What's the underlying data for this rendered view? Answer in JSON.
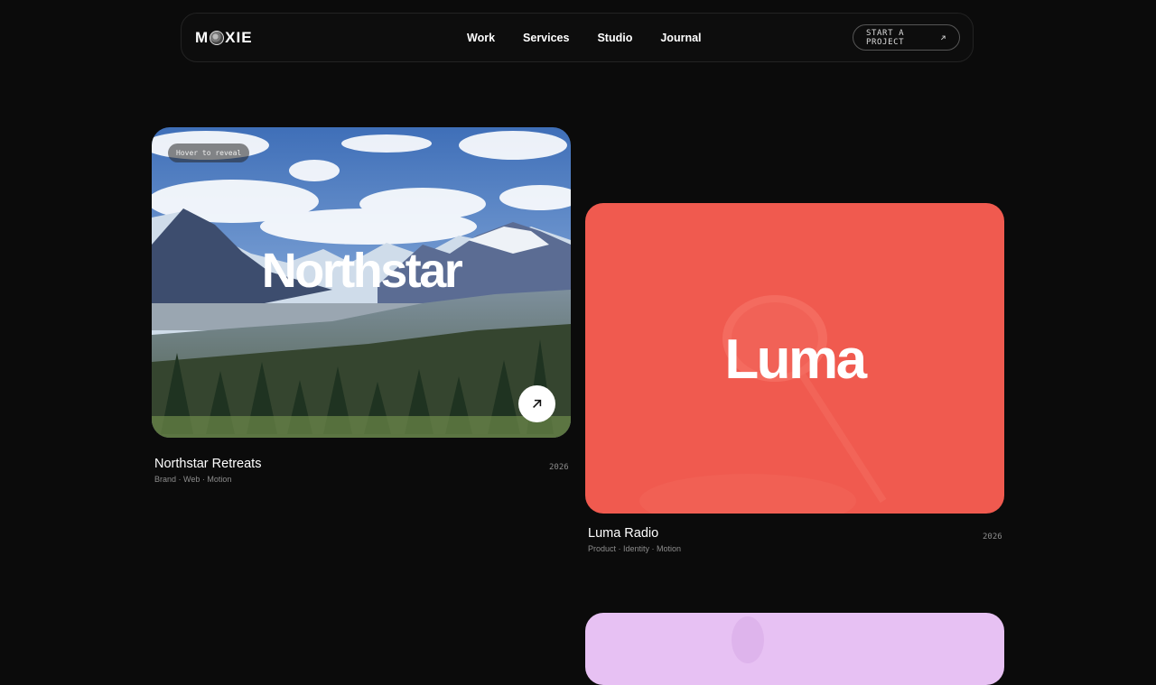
{
  "brand": {
    "logo_left": "M",
    "logo_right": "XIE"
  },
  "nav": {
    "links": [
      "Work",
      "Services",
      "Studio",
      "Journal"
    ],
    "cta_label": "START A PROJECT",
    "cta_icon": "arrow-up-right-icon"
  },
  "projects": [
    {
      "card_title": "Northstar",
      "badge": "Hover to reveal",
      "name": "Northstar Retreats",
      "tags": "Brand · Web · Motion",
      "year": "2026",
      "icon": "arrow-up-right-icon"
    },
    {
      "card_title": "Luma",
      "name": "Luma Radio",
      "tags": "Product · Identity · Motion",
      "year": "2026",
      "color": "#f05a4f"
    },
    {
      "color": "#e7c1f3"
    }
  ],
  "colors": {
    "background": "#0b0b0b",
    "luma": "#f05a4f",
    "lilac": "#e7c1f3"
  }
}
